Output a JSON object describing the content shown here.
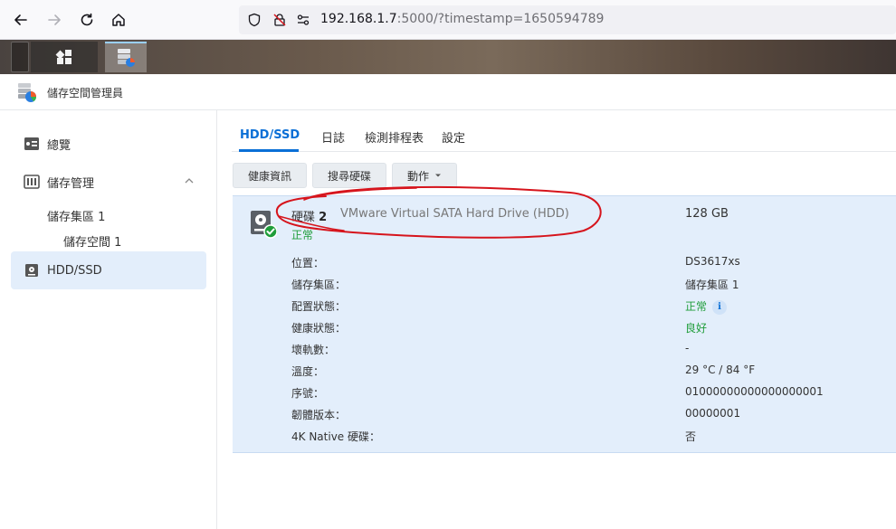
{
  "browser": {
    "url_host": "192.168.1.7",
    "url_rest": ":5000/?timestamp=1650594789",
    "back_icon": "arrow-left-icon",
    "forward_icon": "arrow-right-icon",
    "reload_icon": "reload-icon",
    "home_icon": "home-icon"
  },
  "app": {
    "title": "儲存空間管理員"
  },
  "sidebar": {
    "items": [
      {
        "label": "總覽"
      },
      {
        "label": "儲存管理"
      },
      {
        "label": "儲存集區 1"
      },
      {
        "label": "儲存空間 1"
      },
      {
        "label": "HDD/SSD"
      }
    ]
  },
  "tabs": [
    {
      "label": "HDD/SSD"
    },
    {
      "label": "日誌"
    },
    {
      "label": "檢測排程表"
    },
    {
      "label": "設定"
    }
  ],
  "toolbar": {
    "health": "健康資訊",
    "search": "搜尋硬碟",
    "action": "動作"
  },
  "disk": {
    "name_prefix": "硬碟",
    "number": "2",
    "model": "VMware Virtual SATA Hard Drive (HDD)",
    "size": "128 GB",
    "status": "正常",
    "rows": [
      {
        "label": "位置：",
        "value": "DS3617xs"
      },
      {
        "label": "儲存集區：",
        "value": "儲存集區 1"
      },
      {
        "label": "配置狀態：",
        "value": "正常"
      },
      {
        "label": "健康狀態：",
        "value": "良好"
      },
      {
        "label": "壞軌數：",
        "value": "-"
      },
      {
        "label": "溫度：",
        "value": "29 °C / 84 °F"
      },
      {
        "label": "序號：",
        "value": "01000000000000000001"
      },
      {
        "label": "韌體版本：",
        "value": "00000001"
      },
      {
        "label": "4K Native 硬碟：",
        "value": "否"
      }
    ],
    "info_glyph": "i"
  },
  "colors": {
    "accent": "#0a6fd6",
    "ok": "#1f9d3a",
    "selected_bg": "#e3eefb",
    "annotation": "#d6141c"
  }
}
